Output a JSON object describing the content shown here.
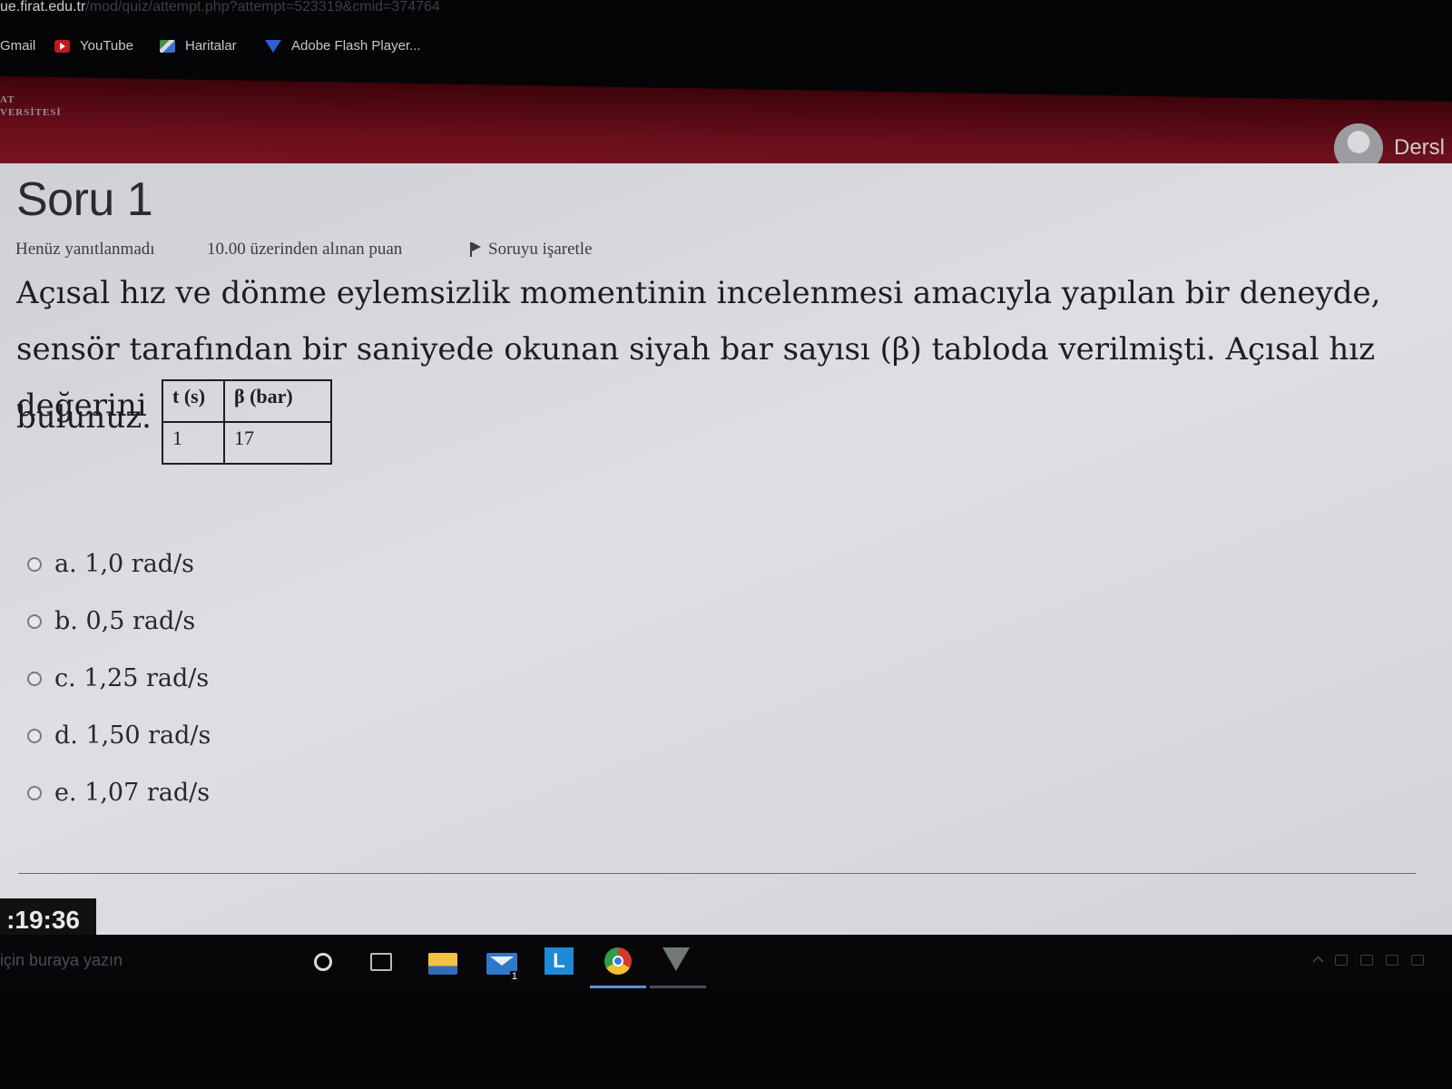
{
  "browser": {
    "host": "ue.firat.edu.tr",
    "path": "/mod/quiz/attempt.php?attempt=523319&cmid=374764",
    "bookmarks": [
      {
        "label": "Gmail",
        "icon": "gmail-icon"
      },
      {
        "label": "YouTube",
        "icon": "youtube-icon"
      },
      {
        "label": "Haritalar",
        "icon": "maps-icon"
      },
      {
        "label": "Adobe Flash Player...",
        "icon": "flash-icon"
      }
    ]
  },
  "header": {
    "logo_line1": "AT",
    "logo_line2": "VERSİTESİ",
    "user_label": "Dersl"
  },
  "question": {
    "title": "Soru 1",
    "status": "Henüz yanıtlanmadı",
    "points": "10.00 üzerinden alınan puan",
    "flag_label": "Soruyu işaretle",
    "text": "Açısal hız ve dönme eylemsizlik momentinin incelenmesi amacıyla yapılan bir deneyde, sensör tarafından bir saniyede okunan siyah bar sayısı (β) tabloda verilmişti. Açısal hız değerini",
    "text_end": "bulunuz.",
    "table": {
      "headers": [
        "t (s)",
        "β (bar)"
      ],
      "rows": [
        [
          "1",
          "17"
        ]
      ]
    },
    "answers": [
      {
        "label": "a. 1,0 rad/s"
      },
      {
        "label": "b. 0,5 rad/s"
      },
      {
        "label": "c. 1,25 rad/s"
      },
      {
        "label": "d. 1,50 rad/s"
      },
      {
        "label": "e. 1,07 rad/s"
      }
    ]
  },
  "timer": ":19:36",
  "taskbar": {
    "search_placeholder": "için buraya yazın",
    "mail_badge": "1",
    "app_letter": "L"
  },
  "colors": {
    "header_red": "#6a0f1c",
    "content_bg": "#d9dadd",
    "text": "#1c1e24"
  }
}
